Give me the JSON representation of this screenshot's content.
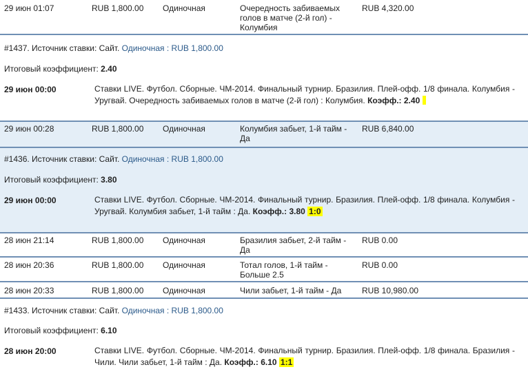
{
  "rows": [
    {
      "date": "29 июн 01:07",
      "amount": "RUB 1,800.00",
      "type": "Одиночная",
      "event": "Очередность забиваемых голов в матче (2-й гол) - Колумбия",
      "win": "RUB 4,320.00"
    },
    {
      "date": "29 июн 00:28",
      "amount": "RUB 1,800.00",
      "type": "Одиночная",
      "event": "Колумбия забьет, 1-й тайм - Да",
      "win": "RUB 6,840.00"
    },
    {
      "date": "28 июн 21:14",
      "amount": "RUB 1,800.00",
      "type": "Одиночная",
      "event": "Бразилия забьет, 2-й тайм - Да",
      "win": "RUB 0.00"
    },
    {
      "date": "28 июн 20:36",
      "amount": "RUB 1,800.00",
      "type": "Одиночная",
      "event": "Тотал голов, 1-й тайм - Больше 2.5",
      "win": "RUB 0.00"
    },
    {
      "date": "28 июн 20:33",
      "amount": "RUB 1,800.00",
      "type": "Одиночная",
      "event": "Чили забьет, 1-й тайм - Да",
      "win": "RUB 10,980.00"
    }
  ],
  "details": [
    {
      "source_prefix": "#1437. Источник ставки: Сайт.",
      "link": "Одиночная : RUB 1,800.00",
      "coef_label": "Итоговый коэффициент:",
      "coef": "2.40",
      "bet_time": "29 июн 00:00",
      "description": "Ставки LIVE. Футбол. Сборные. ЧМ-2014. Финальный турнир. Бразилия. Плей-офф. 1/8 финала. Колумбия - Уругвай. Очередность забиваемых голов в матче (2-й гол) : Колумбия.",
      "coef_text": "Коэфф.: 2.40",
      "score": ""
    },
    {
      "source_prefix": "#1436. Источник ставки: Сайт.",
      "link": "Одиночная : RUB 1,800.00",
      "coef_label": "Итоговый коэффициент:",
      "coef": "3.80",
      "bet_time": "29 июн 00:00",
      "description": "Ставки LIVE. Футбол. Сборные. ЧМ-2014. Финальный турнир. Бразилия. Плей-офф. 1/8 финала. Колумбия - Уругвай. Колумбия забьет, 1-й тайм : Да.",
      "coef_text": "Коэфф.: 3.80",
      "score": "1:0"
    },
    {
      "source_prefix": "#1433. Источник ставки: Сайт.",
      "link": "Одиночная : RUB 1,800.00",
      "coef_label": "Итоговый коэффициент:",
      "coef": "6.10",
      "bet_time": "28 июн 20:00",
      "description": "Ставки LIVE. Футбол. Сборные. ЧМ-2014. Финальный турнир. Бразилия. Плей-офф. 1/8 финала. Бразилия - Чили. Чили забьет, 1-й тайм : Да.",
      "coef_text": "Коэфф.: 6.10",
      "score": "1:1"
    }
  ]
}
